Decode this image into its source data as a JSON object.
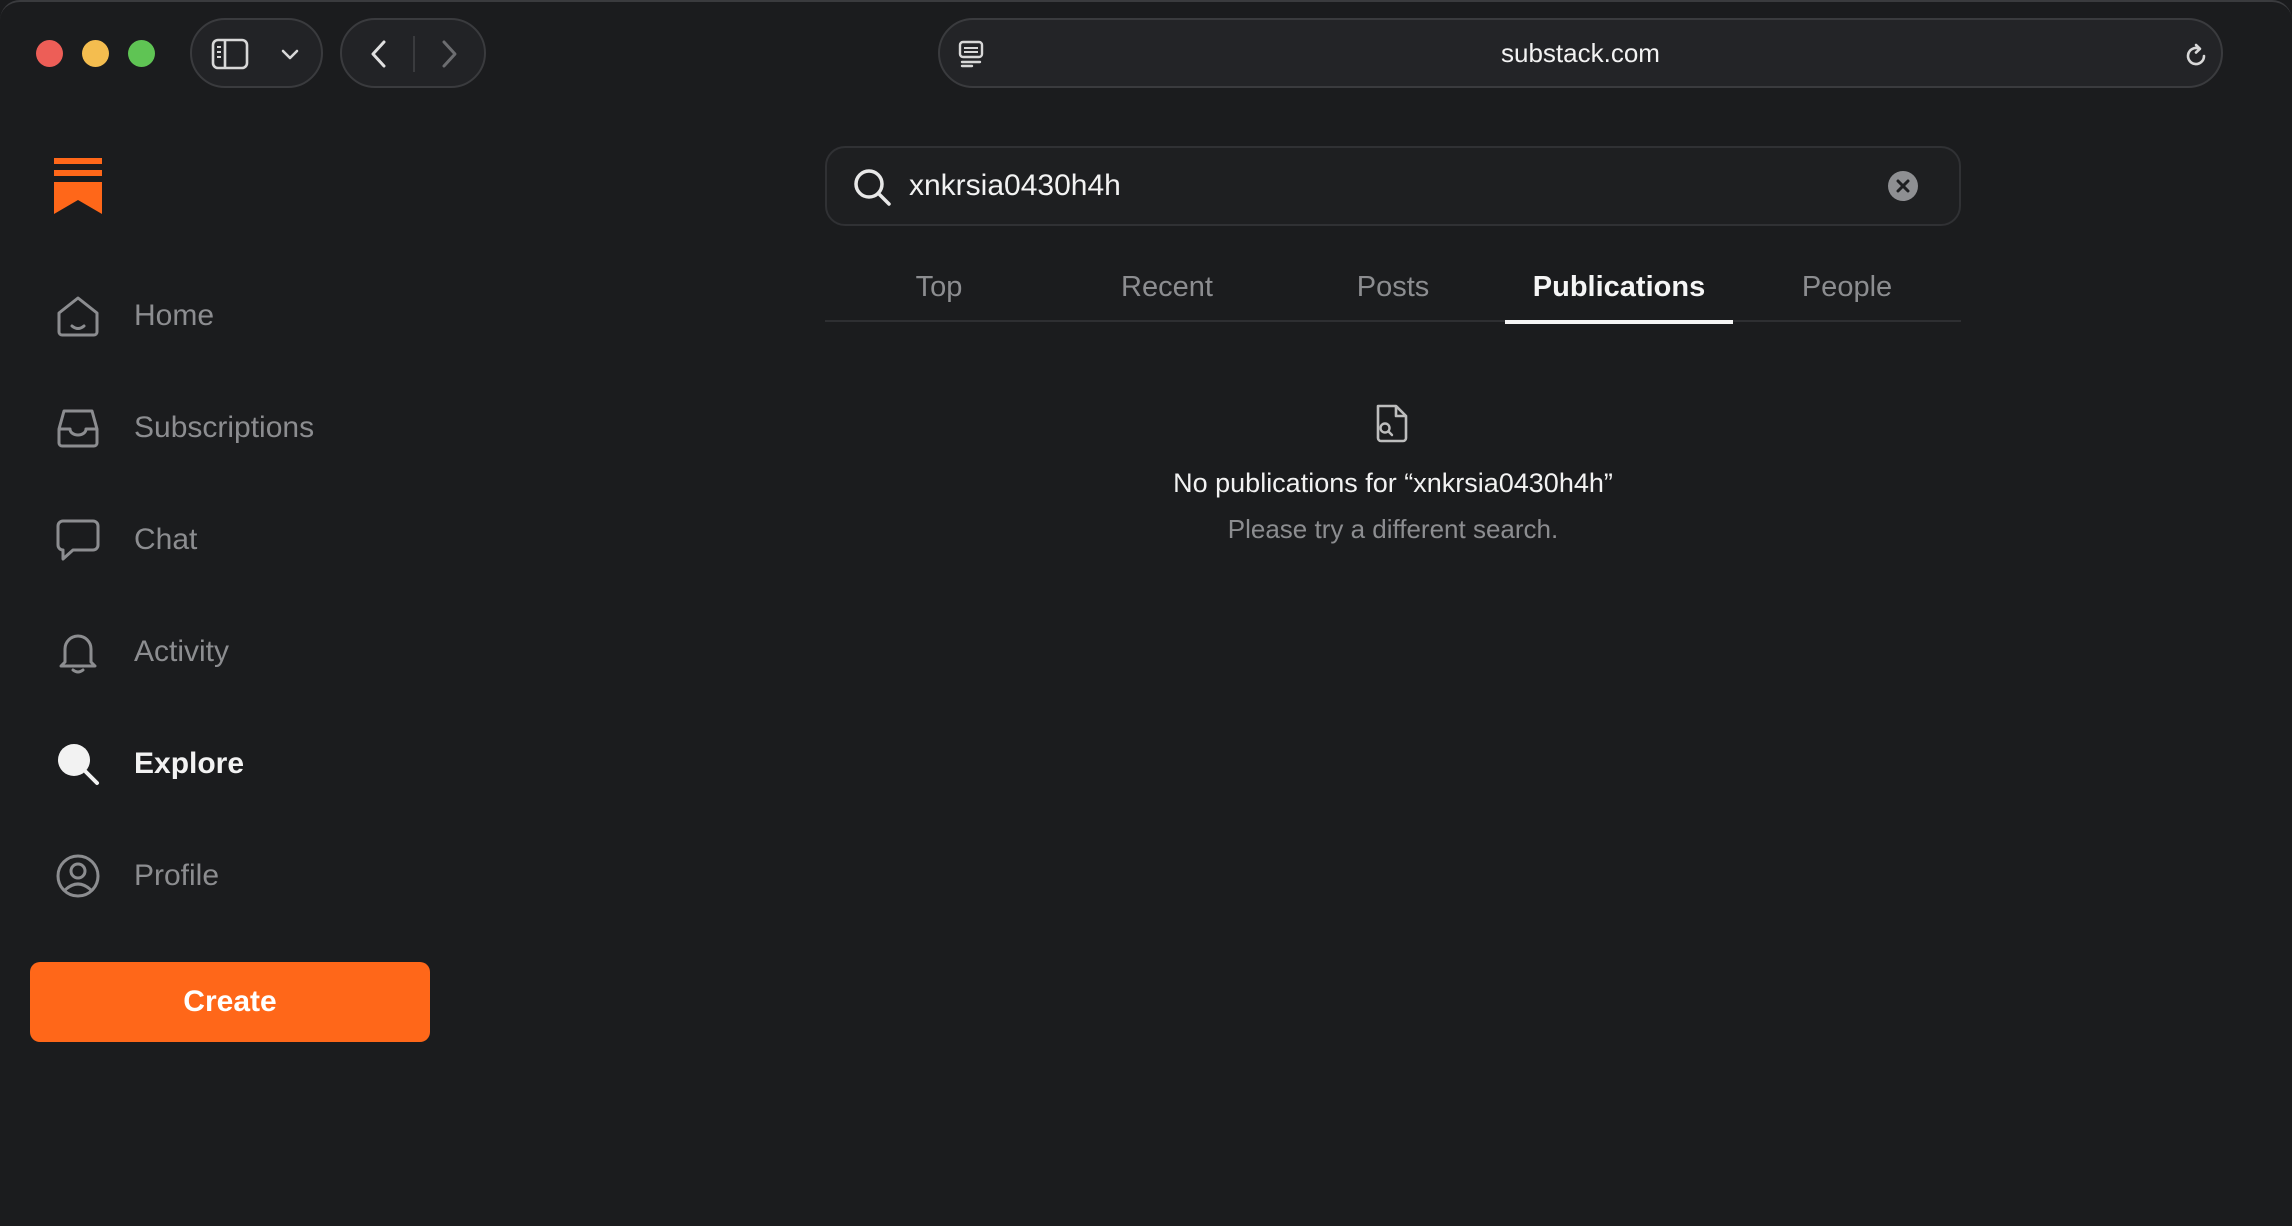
{
  "browser": {
    "url": "substack.com"
  },
  "sidebar": {
    "items": [
      {
        "label": "Home",
        "icon": "home-icon"
      },
      {
        "label": "Subscriptions",
        "icon": "inbox-icon"
      },
      {
        "label": "Chat",
        "icon": "chat-bubble-icon"
      },
      {
        "label": "Activity",
        "icon": "bell-icon"
      },
      {
        "label": "Explore",
        "icon": "search-icon",
        "active": true
      },
      {
        "label": "Profile",
        "icon": "profile-icon"
      }
    ],
    "create_label": "Create"
  },
  "search": {
    "query": "xnkrsia0430h4h"
  },
  "tabs": [
    {
      "label": "Top"
    },
    {
      "label": "Recent"
    },
    {
      "label": "Posts"
    },
    {
      "label": "Publications",
      "active": true
    },
    {
      "label": "People"
    }
  ],
  "empty_state": {
    "title": "No publications for “xnkrsia0430h4h”",
    "subtitle": "Please try a different search."
  },
  "colors": {
    "accent": "#ff6719",
    "background": "#1b1c1e",
    "muted_text": "#8c8d90"
  }
}
